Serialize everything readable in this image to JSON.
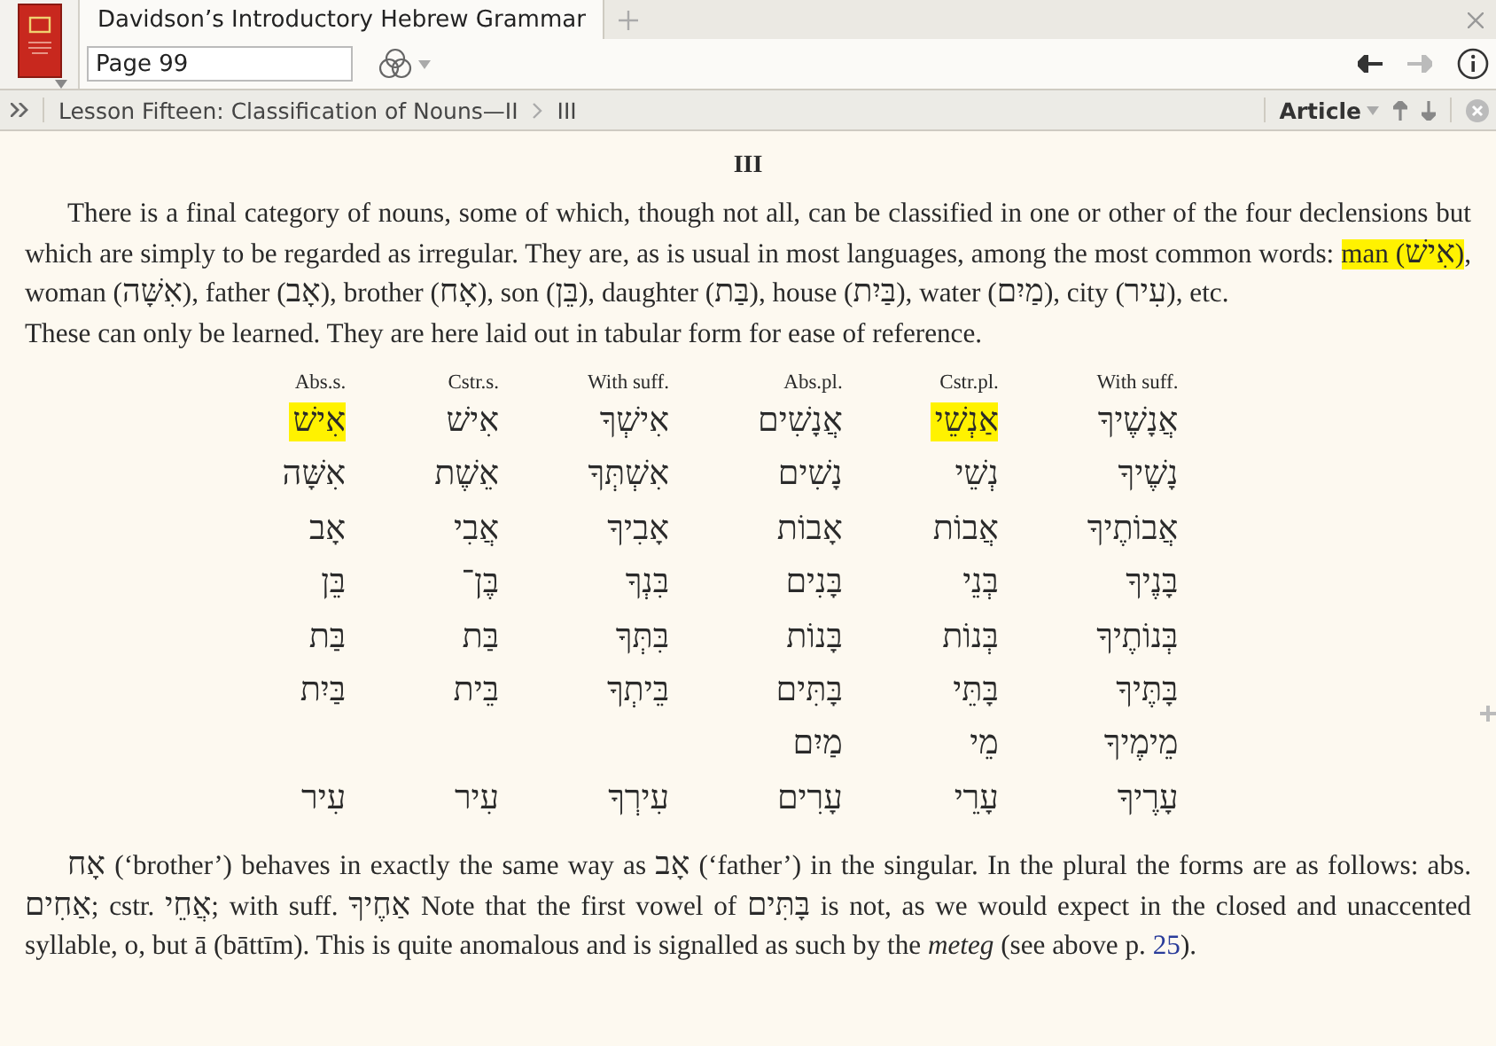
{
  "tab": {
    "title": "Davidson’s Introductory Hebrew Grammar",
    "selected": true
  },
  "toolbar": {
    "page_field": {
      "value": "Page 99"
    },
    "back_enabled": true,
    "forward_enabled": false
  },
  "breadcrumb": {
    "parent": "Lesson Fifteen: Classification of Nouns—II",
    "current": "III"
  },
  "view_menu": {
    "label": "Article"
  },
  "article": {
    "heading": "III",
    "paragraph_1": [
      {
        "text": "There is a final category of nouns, some of which, though not all, can be classified in one or other of the four declensions but which are simply to be regarded as irregular. They are, as is usual in most languages, among the most common words: ",
        "highlighted": false
      },
      {
        "text": "man (אִישׁ)",
        "highlighted": true
      },
      {
        "text": ", woman (אִשָּׁה), father (אָב), brother (אָח), son (בֵּן), daughter (בַּת), house (בַּיִת), water (מַיִם), city (עִיר), etc.",
        "highlighted": false
      }
    ],
    "paragraph_2": "These can only be learned. They are here laid out in tabular form for ease of reference.",
    "table": {
      "headings": [
        "With suff.",
        "Cstr.pl.",
        "Abs.pl.",
        "With suff.",
        "Cstr.s.",
        "Abs.s."
      ],
      "rows": [
        {
          "cells": [
            {
              "text": "אֲנָשֶׁיךָ",
              "highlighted": false
            },
            {
              "text": "אַנְשֵׁי",
              "highlighted": true
            },
            {
              "text": "אֲנָשִׁים",
              "highlighted": false
            },
            {
              "text": "אִישְׁךָ",
              "highlighted": false
            },
            {
              "text": "אִישׁ",
              "highlighted": false
            },
            {
              "text": "אִישׁ",
              "highlighted": true
            }
          ]
        },
        {
          "cells": [
            {
              "text": "נָשֶׁיךָ",
              "highlighted": false
            },
            {
              "text": "נְשֵׁי",
              "highlighted": false
            },
            {
              "text": "נָשִׁים",
              "highlighted": false
            },
            {
              "text": "אִשְׁתְּךָ",
              "highlighted": false
            },
            {
              "text": "אֵשֶׁת",
              "highlighted": false
            },
            {
              "text": "אִשָּׁה",
              "highlighted": false
            }
          ]
        },
        {
          "cells": [
            {
              "text": "אֲבוֹתֶיךָ",
              "highlighted": false
            },
            {
              "text": "אֲבוֹת",
              "highlighted": false
            },
            {
              "text": "אָבוֹת",
              "highlighted": false
            },
            {
              "text": "אָבִיךָ",
              "highlighted": false
            },
            {
              "text": "אֲבִי",
              "highlighted": false
            },
            {
              "text": "אָב",
              "highlighted": false
            }
          ]
        },
        {
          "cells": [
            {
              "text": "בָּנֶיךָ",
              "highlighted": false
            },
            {
              "text": "בְּנֵי",
              "highlighted": false
            },
            {
              "text": "בָּנִים",
              "highlighted": false
            },
            {
              "text": "בִּנְךָ",
              "highlighted": false
            },
            {
              "text": "בֶּן־",
              "highlighted": false
            },
            {
              "text": "בֵּן",
              "highlighted": false
            }
          ]
        },
        {
          "cells": [
            {
              "text": "בְּנוֹתֶיךָ",
              "highlighted": false
            },
            {
              "text": "בְּנוֹת",
              "highlighted": false
            },
            {
              "text": "בָּנוֹת",
              "highlighted": false
            },
            {
              "text": "בִּתְּךָ",
              "highlighted": false
            },
            {
              "text": "בַּת",
              "highlighted": false
            },
            {
              "text": "בַּת",
              "highlighted": false
            }
          ]
        },
        {
          "cells": [
            {
              "text": "בָּתֶּיךָ",
              "highlighted": false
            },
            {
              "text": "בָּתֵּי",
              "highlighted": false
            },
            {
              "text": "בָּתִּים",
              "highlighted": false
            },
            {
              "text": "בֵּיתְךָ",
              "highlighted": false
            },
            {
              "text": "בֵּית",
              "highlighted": false
            },
            {
              "text": "בַּיִת",
              "highlighted": false
            }
          ]
        },
        {
          "cells": [
            {
              "text": "מֵימֶיךָ",
              "highlighted": false
            },
            {
              "text": "מֵי",
              "highlighted": false
            },
            {
              "text": "מַיִם",
              "highlighted": false
            },
            null,
            null,
            null
          ]
        },
        {
          "cells": [
            {
              "text": "עָרֶיךָ",
              "highlighted": false
            },
            {
              "text": "עָרֵי",
              "highlighted": false
            },
            {
              "text": "עָרִים",
              "highlighted": false
            },
            {
              "text": "עִירְךָ",
              "highlighted": false
            },
            {
              "text": "עִיר",
              "highlighted": false
            },
            {
              "text": "עִיר",
              "highlighted": false
            }
          ]
        }
      ]
    },
    "paragraph_3": {
      "text": "אָח (‘brother’) behaves in exactly the same way as אָב (‘father’) in the singular. In the plural the forms are as follows: abs. אַחִים; cstr. אֲחֵי; with suff. אַחֶיךָ Note that the first vowel of בָּתִּים is not, as we would expect in the closed and unaccented syllable, o, but ā (bāttīm). This is quite anomalous and is signalled as such by the *meteg* (see above p. ",
      "link": "25",
      "after": ")."
    }
  }
}
